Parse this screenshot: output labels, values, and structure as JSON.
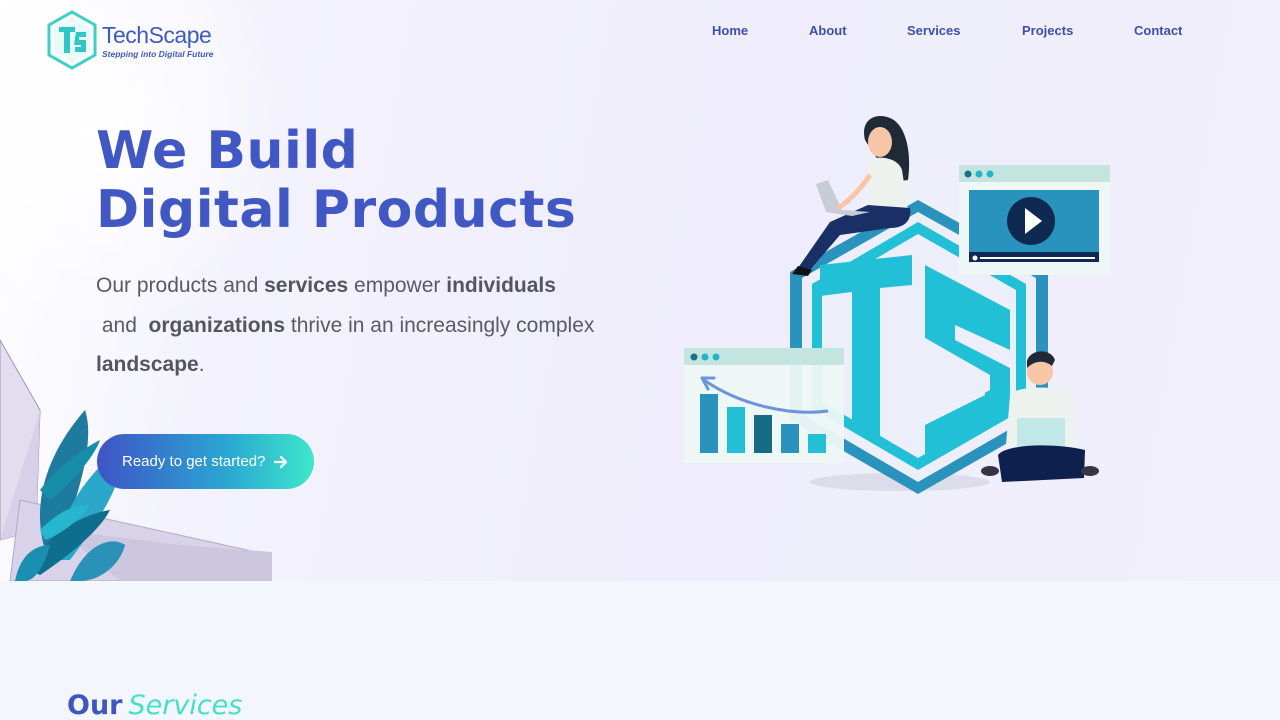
{
  "brand": {
    "name": "TechScape",
    "tagline": "Stepping into Digital Future"
  },
  "nav": {
    "items": [
      {
        "label": "Home"
      },
      {
        "label": "About"
      },
      {
        "label": "Services"
      },
      {
        "label": "Projects"
      },
      {
        "label": "Contact"
      }
    ]
  },
  "hero": {
    "headline_line1": "We Build",
    "headline_line2": "Digital Products",
    "subtitle": {
      "t1": "Our products and ",
      "b1": "services",
      "t2": " empower ",
      "b2": "individuals",
      "t3": " and  ",
      "b3": "organizations",
      "t4": " thrive in an increasingly complex ",
      "b4": "landscape",
      "t5": "."
    },
    "cta_label": "Ready to get started?",
    "cta_icon": "arrow-right-icon"
  },
  "services_section": {
    "title_part1": "Our",
    "title_part2": "Services"
  },
  "colors": {
    "brand_blue": "#4158c4",
    "brand_teal": "#45e0c8",
    "nav_text": "#3e4fa9",
    "body_text": "#5a5a66",
    "illustration_teal": "#22c0d6",
    "illustration_dark": "#2895bd"
  }
}
